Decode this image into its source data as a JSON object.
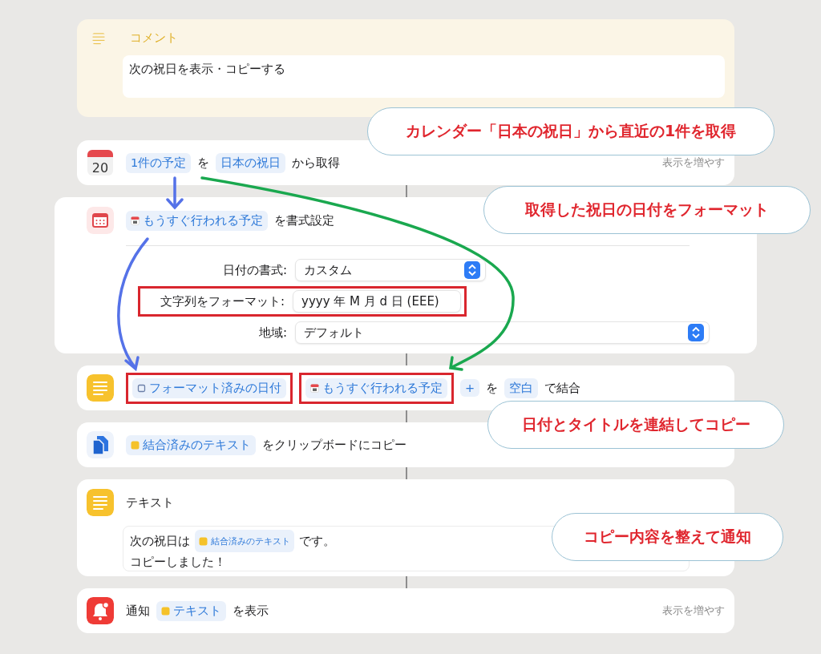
{
  "actions": [
    {
      "kind": "comment",
      "title": "コメント",
      "text": "次の祝日を表示・コピーする"
    },
    {
      "kind": "calendar",
      "icon_label": "20",
      "parts": [
        {
          "kind": "plain",
          "text": "1件の予定",
          "highlighted": false
        },
        {
          "kind": "label",
          "text": "を"
        },
        {
          "kind": "plain",
          "text": "日本の祝日",
          "highlighted": false
        },
        {
          "kind": "label",
          "text": "から取得"
        }
      ],
      "more": "表示を増やす"
    },
    {
      "kind": "format",
      "parts": [
        {
          "kind": "event",
          "text": "もうすぐ行われる予定",
          "highlighted": false
        },
        {
          "kind": "label",
          "text": "を書式設定"
        }
      ],
      "fields": [
        {
          "kind": "popup",
          "label": "日付の書式:",
          "value": "カスタム",
          "highlighted": false
        },
        {
          "kind": "text",
          "label": "文字列をフォーマット:",
          "value": "yyyy 年 M 月 d 日 (EEE)",
          "highlighted": true
        },
        {
          "kind": "popup",
          "label": "地域:",
          "value": "デフォルト",
          "highlighted": false
        }
      ]
    },
    {
      "kind": "combine",
      "parts": [
        {
          "kind": "date",
          "text": "フォーマット済みの日付",
          "highlighted": true
        },
        {
          "kind": "event",
          "text": "もうすぐ行われる予定",
          "highlighted": true
        },
        {
          "kind": "plain",
          "text": "+",
          "highlighted": false
        },
        {
          "kind": "label",
          "text": "を"
        },
        {
          "kind": "plain",
          "text": "空白",
          "highlighted": false
        },
        {
          "kind": "label",
          "text": "で結合"
        }
      ]
    },
    {
      "kind": "clipboard",
      "parts": [
        {
          "kind": "textvar",
          "text": "結合済みのテキスト",
          "highlighted": false
        },
        {
          "kind": "label",
          "text": "をクリップボードにコピー"
        }
      ]
    },
    {
      "kind": "text",
      "title": "テキスト",
      "lines": [
        [
          {
            "kind": "label",
            "text": "次の祝日は"
          },
          {
            "kind": "textvar",
            "text": "結合済みのテキスト",
            "highlighted": false
          },
          {
            "kind": "label",
            "text": "です。"
          }
        ],
        [
          {
            "kind": "label",
            "text": "コピーしました！"
          }
        ]
      ]
    },
    {
      "kind": "notify",
      "parts": [
        {
          "kind": "label",
          "text": "通知"
        },
        {
          "kind": "textvar",
          "text": "テキスト",
          "highlighted": false
        },
        {
          "kind": "label",
          "text": "を表示"
        }
      ],
      "more": "表示を増やす"
    }
  ],
  "callouts": [
    "カレンダー「日本の祝日」から直近の1件を取得",
    "取得した祝日の日付をフォーマット",
    "日付とタイトルを連結してコピー",
    "コピー内容を整えて通知"
  ]
}
